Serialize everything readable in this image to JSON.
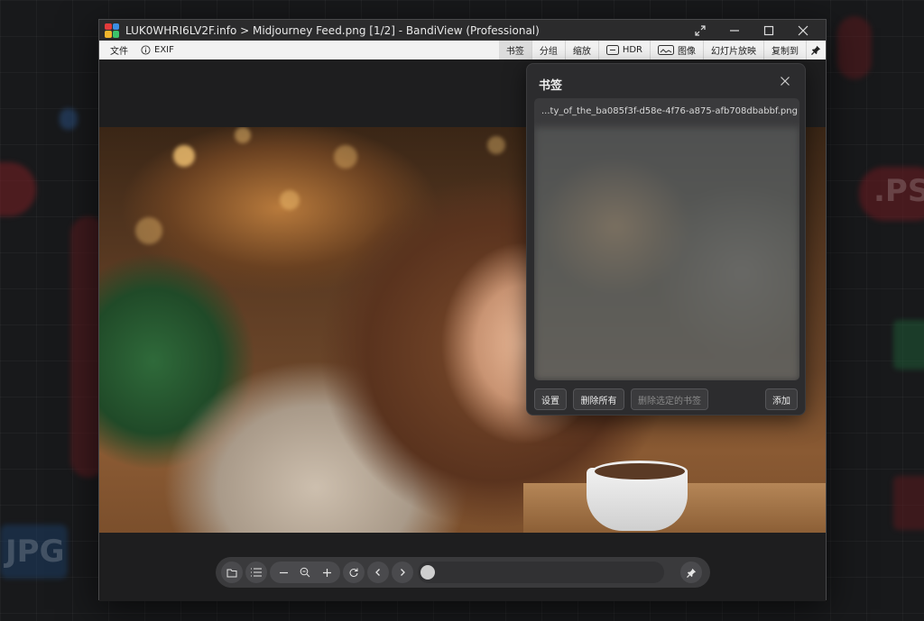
{
  "window": {
    "title": "LUK0WHRI6LV2F.info > Midjourney Feed.png [1/2] - BandiView (Professional)"
  },
  "menu": {
    "file": "文件",
    "exif": "EXIF",
    "bookmark": "书签",
    "split": "分组",
    "zoom": "缩放",
    "hdr": "HDR",
    "image": "图像",
    "slideshow": "幻灯片放映",
    "copy_to": "复制到"
  },
  "bookmark_panel": {
    "title": "书签",
    "items": [
      "...ty_of_the_ba085f3f-d58e-4f76-a875-afb708dbabbf.png"
    ],
    "settings_label": "设置",
    "delete_all_label": "删除所有",
    "delete_selected_label": "删除选定的书签",
    "add_label": "添加"
  },
  "background": {
    "labels": [
      "JPG",
      ".PS"
    ]
  },
  "colors": {
    "titlebar": "#2b2b2c",
    "menubar": "#f2f2f2",
    "panel": "#2c2c2e",
    "toolbar": "#3a3a3c"
  },
  "icons": {
    "app": "bandiview-logo-icon",
    "exif": "info-circle-icon",
    "hdr": "hdr-icon",
    "image": "image-icon",
    "pin": "pin-icon",
    "open": "folder-open-icon",
    "list": "list-icon",
    "zoom_out": "minus-icon",
    "zoom": "magnifier-icon",
    "zoom_in": "plus-icon",
    "rotate": "rotate-icon",
    "prev": "chevron-left-icon",
    "next": "chevron-right-icon"
  }
}
